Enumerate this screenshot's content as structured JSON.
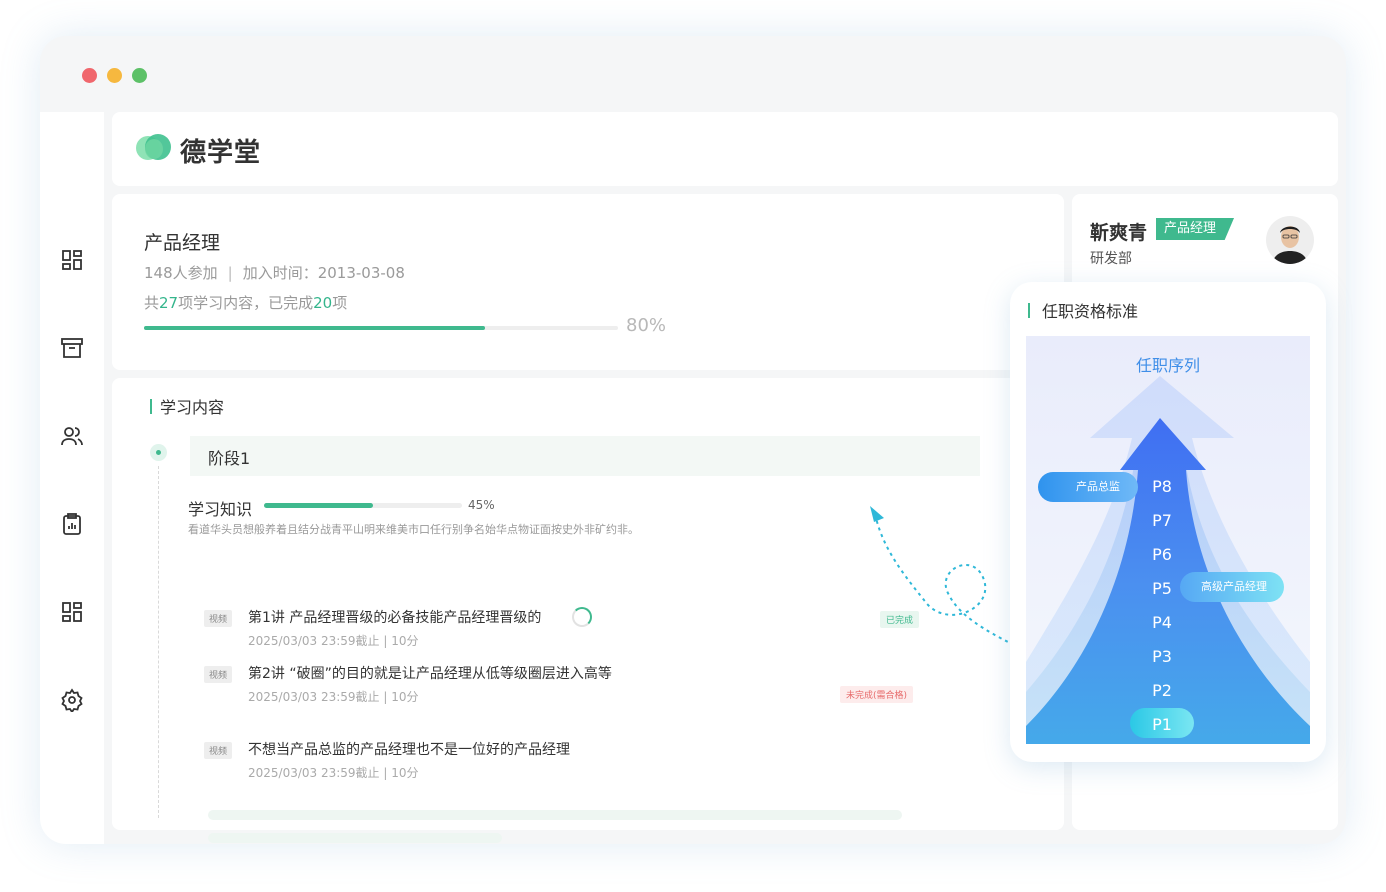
{
  "window": {
    "dots": [
      "close",
      "minimize",
      "maximize"
    ]
  },
  "sidebar": {
    "icons": [
      "dashboard-icon",
      "archive-icon",
      "users-icon",
      "clipboard-chart-icon",
      "grid-icon",
      "gear-icon"
    ]
  },
  "brand": {
    "name": "德学堂"
  },
  "course": {
    "title": "产品经理",
    "participants": "148人参加",
    "join_time": "加入时间：2013-03-08",
    "count_prefix": "共",
    "total_items": "27",
    "count_middle": "项学习内容，已完成",
    "done_items": "20",
    "count_suffix": "项",
    "progress": 0.72,
    "progress_label": "80%"
  },
  "content": {
    "section_title": "学习内容",
    "stage": "阶段1",
    "knowledge_title": "学习知识",
    "knowledge_progress": 0.55,
    "knowledge_pct": "45%",
    "knowledge_desc": "看道华头员想般养着且结分战青平山明来维美市口任行别争名始华点物证面按史外非矿约非。",
    "lessons": [
      {
        "tag": "视频",
        "title": "第1讲 产品经理晋级的必备技能产品经理晋级的",
        "meta": "2025/03/03 23:59截止 | 10分"
      },
      {
        "tag": "视频",
        "title": "第2讲 “破圈”的目的就是让产品经理从低等级圈层进入高等",
        "meta": "2025/03/03 23:59截止 | 10分"
      },
      {
        "tag": "视频",
        "title": "不想当产品总监的产品经理也不是一位好的产品经理",
        "meta": "2025/03/03 23:59截止 | 10分"
      }
    ],
    "status_done": "已完成",
    "status_undone": "未完成(需合格)"
  },
  "user": {
    "name": "靳爽青",
    "badge": "产品经理",
    "dept": "研发部"
  },
  "qualification": {
    "title": "任职资格标准",
    "chart_title": "任职序列",
    "levels": [
      "P8",
      "P7",
      "P6",
      "P5",
      "P4",
      "P3",
      "P2",
      "P1"
    ],
    "role_high": "产品总监",
    "role_mid": "高级产品经理"
  },
  "colors": {
    "accent": "#3fb98e",
    "blue": "#3f8ee8",
    "error": "#e76b6b"
  }
}
